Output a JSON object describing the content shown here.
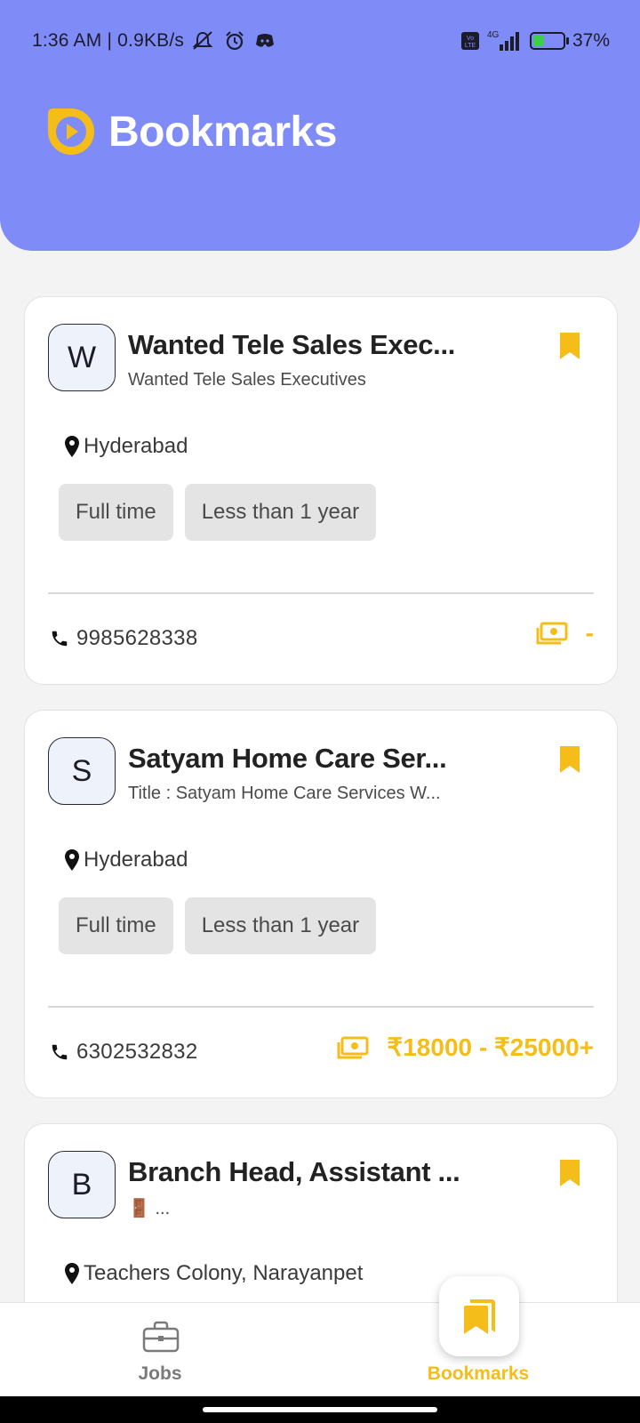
{
  "status_bar": {
    "time": "1:36 AM | 0.9KB/s",
    "network": "4G",
    "volte": "Vo LTE",
    "battery": "37%"
  },
  "header": {
    "title": "Bookmarks"
  },
  "jobs": [
    {
      "initial": "W",
      "title": "Wanted Tele Sales Exec...",
      "subtitle": "Wanted Tele Sales Executives",
      "location": "Hyderabad",
      "tags": [
        "Full time",
        "Less than 1 year"
      ],
      "phone": "9985628338",
      "salary": "-"
    },
    {
      "initial": "S",
      "title": "Satyam Home Care Ser...",
      "subtitle": "Title : Satyam Home Care Services W...",
      "location": "Hyderabad",
      "tags": [
        "Full time",
        "Less than 1 year"
      ],
      "phone": "6302532832",
      "salary": "₹18000 - ₹25000+"
    },
    {
      "initial": "B",
      "title": "Branch Head, Assistant ...",
      "subtitle": "🚪 ...",
      "location": "Teachers Colony, Narayanpet"
    }
  ],
  "bottom_nav": {
    "jobs_label": "Jobs",
    "bookmarks_label": "Bookmarks"
  },
  "colors": {
    "header_bg": "#7f8cf8",
    "accent": "#f5bd1a",
    "page_bg": "#f3f3f4"
  }
}
